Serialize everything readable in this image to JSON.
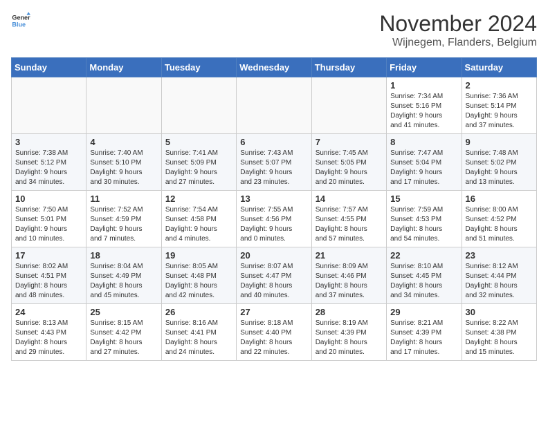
{
  "logo": {
    "general": "General",
    "blue": "Blue"
  },
  "header": {
    "month": "November 2024",
    "location": "Wijnegem, Flanders, Belgium"
  },
  "weekdays": [
    "Sunday",
    "Monday",
    "Tuesday",
    "Wednesday",
    "Thursday",
    "Friday",
    "Saturday"
  ],
  "weeks": [
    [
      {
        "day": "",
        "sunrise": "",
        "sunset": "",
        "daylight": ""
      },
      {
        "day": "",
        "sunrise": "",
        "sunset": "",
        "daylight": ""
      },
      {
        "day": "",
        "sunrise": "",
        "sunset": "",
        "daylight": ""
      },
      {
        "day": "",
        "sunrise": "",
        "sunset": "",
        "daylight": ""
      },
      {
        "day": "",
        "sunrise": "",
        "sunset": "",
        "daylight": ""
      },
      {
        "day": "1",
        "sunrise": "Sunrise: 7:34 AM",
        "sunset": "Sunset: 5:16 PM",
        "daylight": "Daylight: 9 hours and 41 minutes."
      },
      {
        "day": "2",
        "sunrise": "Sunrise: 7:36 AM",
        "sunset": "Sunset: 5:14 PM",
        "daylight": "Daylight: 9 hours and 37 minutes."
      }
    ],
    [
      {
        "day": "3",
        "sunrise": "Sunrise: 7:38 AM",
        "sunset": "Sunset: 5:12 PM",
        "daylight": "Daylight: 9 hours and 34 minutes."
      },
      {
        "day": "4",
        "sunrise": "Sunrise: 7:40 AM",
        "sunset": "Sunset: 5:10 PM",
        "daylight": "Daylight: 9 hours and 30 minutes."
      },
      {
        "day": "5",
        "sunrise": "Sunrise: 7:41 AM",
        "sunset": "Sunset: 5:09 PM",
        "daylight": "Daylight: 9 hours and 27 minutes."
      },
      {
        "day": "6",
        "sunrise": "Sunrise: 7:43 AM",
        "sunset": "Sunset: 5:07 PM",
        "daylight": "Daylight: 9 hours and 23 minutes."
      },
      {
        "day": "7",
        "sunrise": "Sunrise: 7:45 AM",
        "sunset": "Sunset: 5:05 PM",
        "daylight": "Daylight: 9 hours and 20 minutes."
      },
      {
        "day": "8",
        "sunrise": "Sunrise: 7:47 AM",
        "sunset": "Sunset: 5:04 PM",
        "daylight": "Daylight: 9 hours and 17 minutes."
      },
      {
        "day": "9",
        "sunrise": "Sunrise: 7:48 AM",
        "sunset": "Sunset: 5:02 PM",
        "daylight": "Daylight: 9 hours and 13 minutes."
      }
    ],
    [
      {
        "day": "10",
        "sunrise": "Sunrise: 7:50 AM",
        "sunset": "Sunset: 5:01 PM",
        "daylight": "Daylight: 9 hours and 10 minutes."
      },
      {
        "day": "11",
        "sunrise": "Sunrise: 7:52 AM",
        "sunset": "Sunset: 4:59 PM",
        "daylight": "Daylight: 9 hours and 7 minutes."
      },
      {
        "day": "12",
        "sunrise": "Sunrise: 7:54 AM",
        "sunset": "Sunset: 4:58 PM",
        "daylight": "Daylight: 9 hours and 4 minutes."
      },
      {
        "day": "13",
        "sunrise": "Sunrise: 7:55 AM",
        "sunset": "Sunset: 4:56 PM",
        "daylight": "Daylight: 9 hours and 0 minutes."
      },
      {
        "day": "14",
        "sunrise": "Sunrise: 7:57 AM",
        "sunset": "Sunset: 4:55 PM",
        "daylight": "Daylight: 8 hours and 57 minutes."
      },
      {
        "day": "15",
        "sunrise": "Sunrise: 7:59 AM",
        "sunset": "Sunset: 4:53 PM",
        "daylight": "Daylight: 8 hours and 54 minutes."
      },
      {
        "day": "16",
        "sunrise": "Sunrise: 8:00 AM",
        "sunset": "Sunset: 4:52 PM",
        "daylight": "Daylight: 8 hours and 51 minutes."
      }
    ],
    [
      {
        "day": "17",
        "sunrise": "Sunrise: 8:02 AM",
        "sunset": "Sunset: 4:51 PM",
        "daylight": "Daylight: 8 hours and 48 minutes."
      },
      {
        "day": "18",
        "sunrise": "Sunrise: 8:04 AM",
        "sunset": "Sunset: 4:49 PM",
        "daylight": "Daylight: 8 hours and 45 minutes."
      },
      {
        "day": "19",
        "sunrise": "Sunrise: 8:05 AM",
        "sunset": "Sunset: 4:48 PM",
        "daylight": "Daylight: 8 hours and 42 minutes."
      },
      {
        "day": "20",
        "sunrise": "Sunrise: 8:07 AM",
        "sunset": "Sunset: 4:47 PM",
        "daylight": "Daylight: 8 hours and 40 minutes."
      },
      {
        "day": "21",
        "sunrise": "Sunrise: 8:09 AM",
        "sunset": "Sunset: 4:46 PM",
        "daylight": "Daylight: 8 hours and 37 minutes."
      },
      {
        "day": "22",
        "sunrise": "Sunrise: 8:10 AM",
        "sunset": "Sunset: 4:45 PM",
        "daylight": "Daylight: 8 hours and 34 minutes."
      },
      {
        "day": "23",
        "sunrise": "Sunrise: 8:12 AM",
        "sunset": "Sunset: 4:44 PM",
        "daylight": "Daylight: 8 hours and 32 minutes."
      }
    ],
    [
      {
        "day": "24",
        "sunrise": "Sunrise: 8:13 AM",
        "sunset": "Sunset: 4:43 PM",
        "daylight": "Daylight: 8 hours and 29 minutes."
      },
      {
        "day": "25",
        "sunrise": "Sunrise: 8:15 AM",
        "sunset": "Sunset: 4:42 PM",
        "daylight": "Daylight: 8 hours and 27 minutes."
      },
      {
        "day": "26",
        "sunrise": "Sunrise: 8:16 AM",
        "sunset": "Sunset: 4:41 PM",
        "daylight": "Daylight: 8 hours and 24 minutes."
      },
      {
        "day": "27",
        "sunrise": "Sunrise: 8:18 AM",
        "sunset": "Sunset: 4:40 PM",
        "daylight": "Daylight: 8 hours and 22 minutes."
      },
      {
        "day": "28",
        "sunrise": "Sunrise: 8:19 AM",
        "sunset": "Sunset: 4:39 PM",
        "daylight": "Daylight: 8 hours and 20 minutes."
      },
      {
        "day": "29",
        "sunrise": "Sunrise: 8:21 AM",
        "sunset": "Sunset: 4:39 PM",
        "daylight": "Daylight: 8 hours and 17 minutes."
      },
      {
        "day": "30",
        "sunrise": "Sunrise: 8:22 AM",
        "sunset": "Sunset: 4:38 PM",
        "daylight": "Daylight: 8 hours and 15 minutes."
      }
    ]
  ]
}
